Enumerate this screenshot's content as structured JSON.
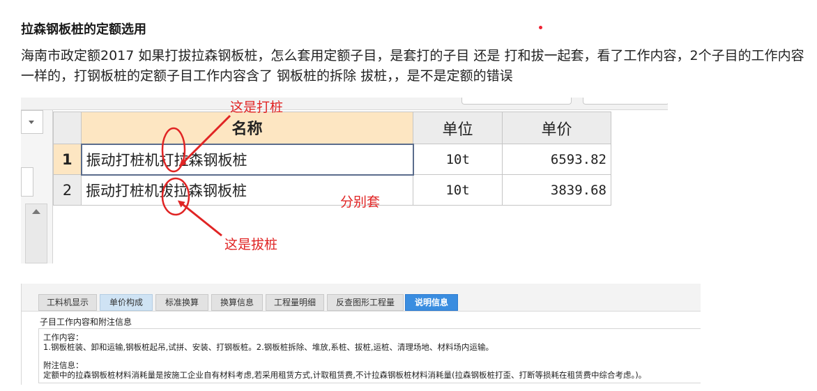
{
  "post": {
    "title": "拉森钢板桩的定额选用",
    "body": "海南市政定额2017  如果打拔拉森钢板桩，怎么套用定额子目，是套打的子目 还是 打和拔一起套，看了工作内容，2个子目的工作内容一样的，打钢板桩的定额子目工作内容含了 钢板桩的拆除 拔桩，，是不是定额的错误"
  },
  "screenshot1": {
    "columns": {
      "name": "名称",
      "unit": "单位",
      "price": "单价"
    },
    "rows": [
      {
        "index": "1",
        "name": "振动打桩机打拉森钢板桩",
        "unit": "10t",
        "price": "6593.82"
      },
      {
        "index": "2",
        "name": "振动打桩机拔拉森钢板桩",
        "unit": "10t",
        "price": "3839.68"
      }
    ],
    "annotations": {
      "drive": "这是打桩",
      "extract": "这是拔桩",
      "separate": "分别套"
    },
    "annotation_color": "#e02424"
  },
  "screenshot2": {
    "tabs": [
      "工料机显示",
      "单价构成",
      "标准换算",
      "换算信息",
      "工程量明细",
      "反查图形工程量",
      "说明信息"
    ],
    "active_tab": "说明信息",
    "heading": "子目工作内容和附注信息",
    "work_label": "工作内容：",
    "work_text": "1.钢板桩装、卸和运输,钢板桩起吊,试拼、安装、打钢板桩。2.钢板桩拆除、堆放,系桩、拔桩,运桩、清理场地、材料场内运输。",
    "note_label": "附注信息：",
    "note_text": "定额中的拉森钢板桩材料消耗量是按施工企业自有材料考虑,若采用租赁方式,计取租赁费,不计拉森钢板桩材料消耗量(拉森钢板桩打歪、打断等损耗在租赁费中综合考虑。)。",
    "active_tab_color": "#3a8de0"
  }
}
